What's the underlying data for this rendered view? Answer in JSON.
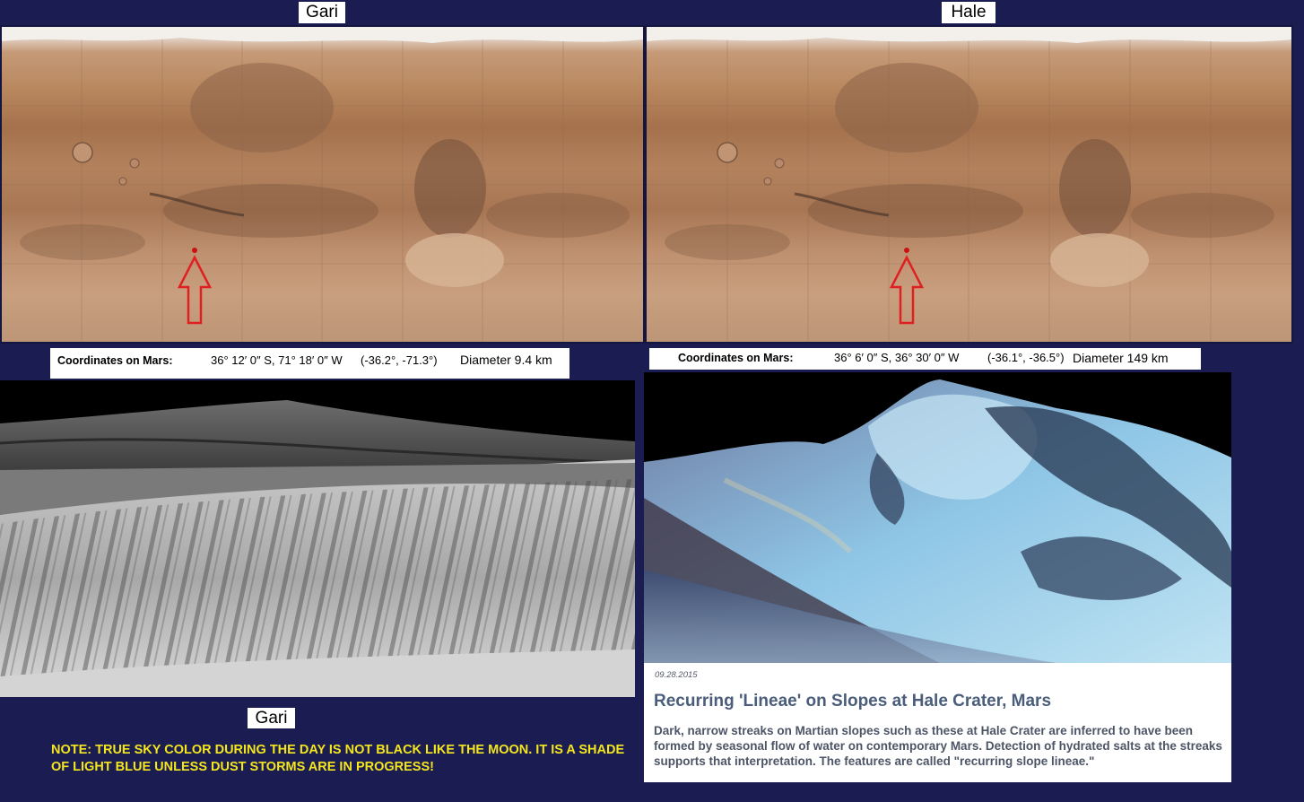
{
  "left": {
    "map_title": "Gari",
    "coordinates_label": "Coordinates on Mars:",
    "coordinates_dms": "36° 12′ 0″ S, 71° 18′ 0″ W",
    "coordinates_decimal": "(-36.2°, -71.3°)",
    "diameter": "Diameter 9.4 km",
    "photo_caption": "Gari"
  },
  "right": {
    "map_title": "Hale",
    "coordinates_label": "Coordinates on Mars:",
    "coordinates_dms": "36° 6′ 0″ S, 36° 30′ 0″ W",
    "coordinates_decimal": "(-36.1°, -36.5°)",
    "diameter": "Diameter 149 km"
  },
  "note": "NOTE: TRUE SKY COLOR DURING THE DAY IS NOT BLACK LIKE THE MOON. IT IS A SHADE OF LIGHT BLUE UNLESS DUST STORMS ARE IN PROGRESS!",
  "article": {
    "date": "09.28.2015",
    "title": "Recurring 'Lineae' on Slopes at Hale Crater, Mars",
    "body": "Dark, narrow streaks on Martian slopes such as these at Hale Crater are inferred to have been formed by seasonal flow of water on contemporary Mars. Detection of hydrated salts at the streaks supports that interpretation. The features are called \"recurring slope lineae.\""
  },
  "colors": {
    "background": "#1a1c52",
    "note_text": "#f4e61c",
    "marker": "#cc1111",
    "arrow": "#e02020"
  },
  "icons": [
    "location-marker-icon",
    "up-arrow-icon"
  ]
}
